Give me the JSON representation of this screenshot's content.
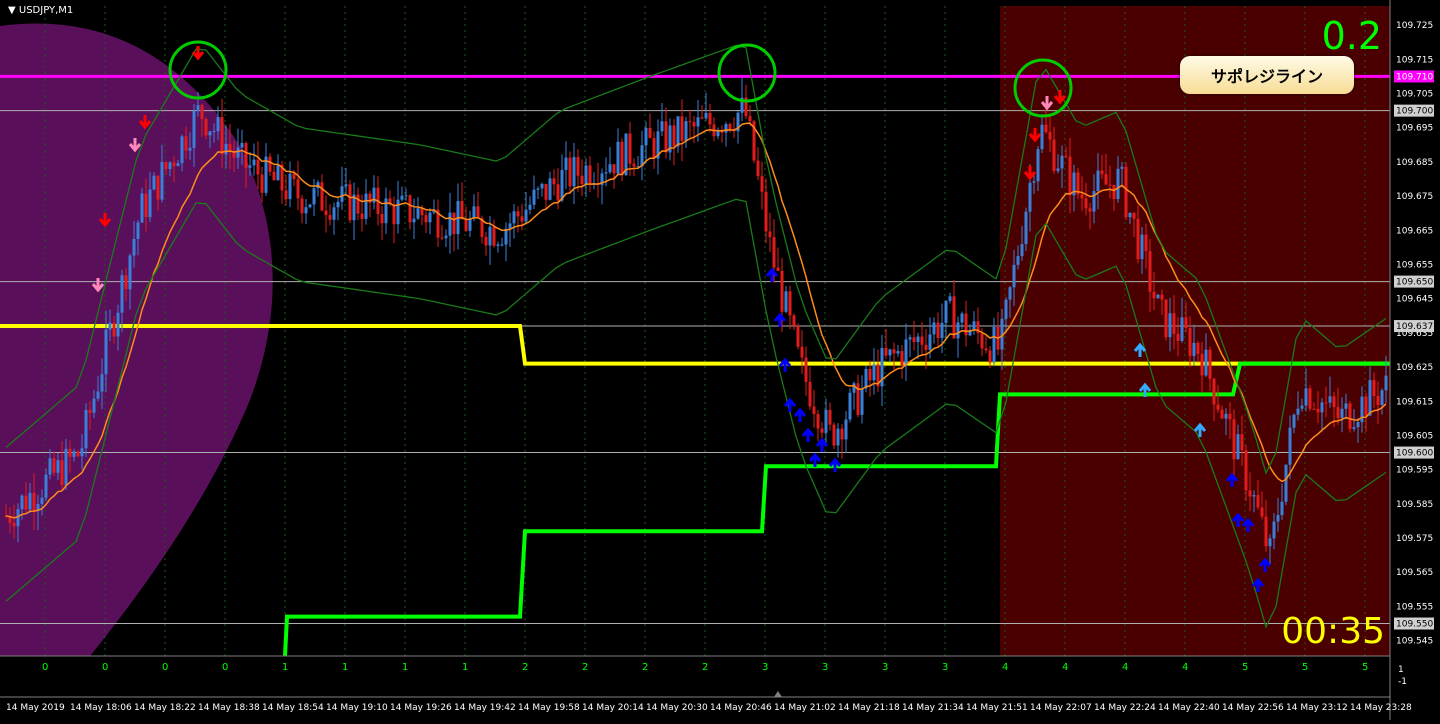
{
  "window": {
    "symbol": "USDJPY,M1"
  },
  "spread_value": "0.2",
  "timer": "00:35",
  "callout_label": "サポレジライン",
  "colors": {
    "background": "#000000",
    "grid": "#2a2a2a",
    "bull_candle": "#3a7fd9",
    "bear_candle": "#e21b1b",
    "ema_line": "#ff8c1a",
    "bands": "#1a7a1a",
    "support_resistance": "#ff00ff",
    "yellow_line": "#ffff00",
    "green_step": "#00ff00",
    "tokyo_session": "#5a0f5a",
    "ny_session": "#4a0000",
    "circle": "#00cc00",
    "up_arrow": "#0000ff",
    "down_arrow": "#ff0000"
  },
  "price_axis": {
    "labels": [
      "109.725",
      "109.715",
      "109.705",
      "109.695",
      "109.685",
      "109.675",
      "109.665",
      "109.655",
      "109.645",
      "109.635",
      "109.625",
      "109.615",
      "109.605",
      "109.595",
      "109.585",
      "109.575",
      "109.565",
      "109.555",
      "109.545"
    ],
    "highlighted": [
      "109.710",
      "109.700",
      "109.650",
      "109.637",
      "109.600",
      "109.550"
    ]
  },
  "time_axis": {
    "labels": [
      "14 May 2019",
      "14 May 18:06",
      "14 May 18:22",
      "14 May 18:38",
      "14 May 18:54",
      "14 May 19:10",
      "14 May 19:26",
      "14 May 19:42",
      "14 May 19:58",
      "14 May 20:14",
      "14 May 20:30",
      "14 May 20:46",
      "14 May 21:02",
      "14 May 21:18",
      "14 May 21:34",
      "14 May 21:51",
      "14 May 22:07",
      "14 May 22:24",
      "14 May 22:40",
      "14 May 22:56",
      "14 May 23:12",
      "14 May 23:28"
    ]
  },
  "indicator_axis": {
    "values": [
      "0",
      "0",
      "0",
      "0",
      "1",
      "1",
      "1",
      "1",
      "2",
      "2",
      "2",
      "2",
      "3",
      "3",
      "3",
      "3",
      "4",
      "4",
      "4",
      "4",
      "5",
      "5",
      "5"
    ],
    "right_labels": [
      "1",
      "-1"
    ]
  },
  "chart_data": {
    "type": "candlestick",
    "symbol": "USDJPY",
    "timeframe": "M1",
    "ylim": [
      109.54,
      109.73
    ],
    "lines": {
      "resistance": 109.71,
      "support_levels": [
        109.7,
        109.65,
        109.637,
        109.6,
        109.55
      ]
    },
    "candles_summary": {
      "start_price": 109.58,
      "high": 109.712,
      "low": 109.556,
      "last": 109.62
    }
  }
}
